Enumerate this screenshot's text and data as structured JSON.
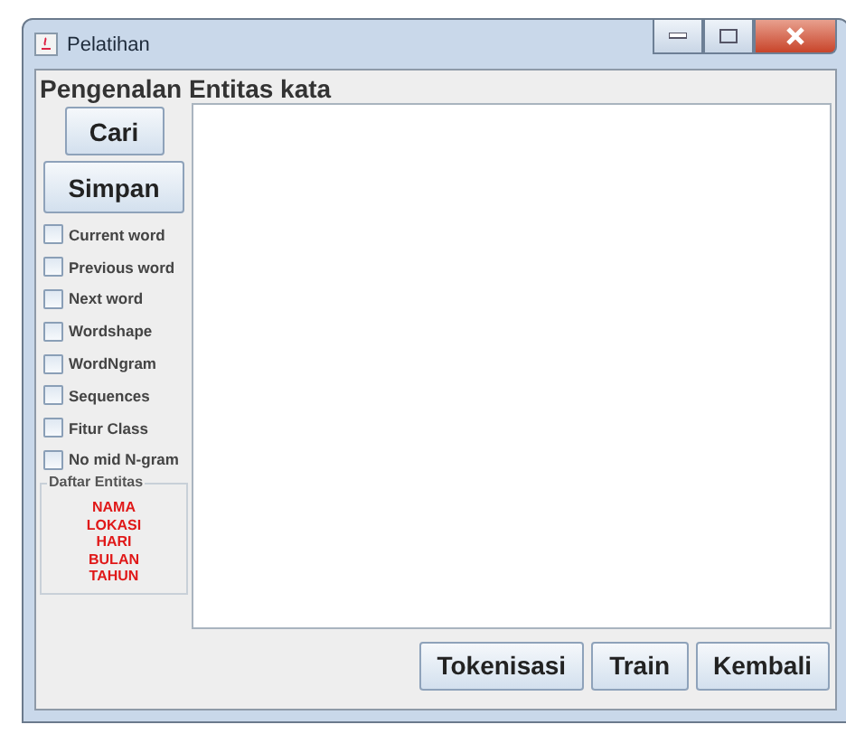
{
  "window": {
    "title": "Pelatihan"
  },
  "heading": "Pengenalan Entitas kata",
  "side_buttons": [
    "Cari",
    "Simpan"
  ],
  "features": [
    {
      "label": "Current word",
      "checked": false
    },
    {
      "label": "Previous word",
      "checked": false
    },
    {
      "label": "Next word",
      "checked": false
    },
    {
      "label": "Wordshape",
      "checked": false
    },
    {
      "label": "WordNgram",
      "checked": false
    },
    {
      "label": "Sequences",
      "checked": false
    },
    {
      "label": "Fitur Class",
      "checked": false
    },
    {
      "label": "No mid N-gram",
      "checked": false
    }
  ],
  "entity_list": {
    "title": "Daftar Entitas",
    "items": [
      "NAMA",
      "LOKASI",
      "HARI",
      "BULAN",
      "TAHUN"
    ]
  },
  "bottom_buttons": [
    "Tokenisasi",
    "Train",
    "Kembali"
  ]
}
